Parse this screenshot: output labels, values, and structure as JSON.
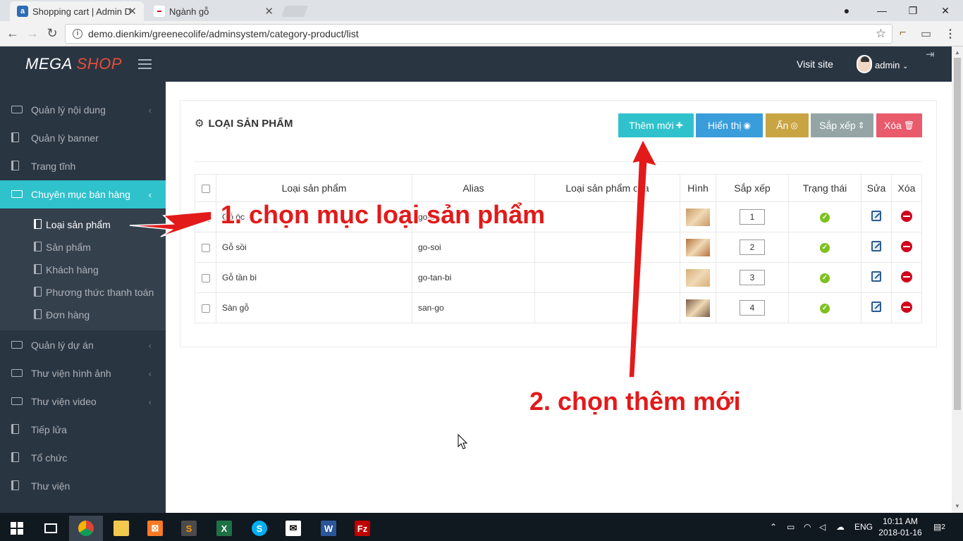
{
  "browser": {
    "tabs": [
      {
        "title": "Shopping cart | Admin D",
        "favicon": "a"
      },
      {
        "title": "Ngành gỗ",
        "favicon": "logo"
      }
    ],
    "url": "demo.dienkim/greenecolife/adminsystem/category-product/list"
  },
  "header": {
    "logo_mega": "MEGA",
    "logo_shop": "SHOP",
    "visit_site": "Visit site",
    "user": "admin"
  },
  "sidebar": {
    "items": [
      {
        "label": "Quản lý nội dung",
        "icon": "folder-icon",
        "chevron": true
      },
      {
        "label": "Quản lý banner",
        "icon": "book-icon",
        "chevron": false
      },
      {
        "label": "Trang tĩnh",
        "icon": "book-icon",
        "chevron": false
      },
      {
        "label": "Chuyên mục bán hàng",
        "icon": "folder-open-icon",
        "chevron": true,
        "active": true
      },
      {
        "label": "Quản lý dự án",
        "icon": "folder-icon",
        "chevron": true
      },
      {
        "label": "Thư viện hình ảnh",
        "icon": "folder-icon",
        "chevron": true
      },
      {
        "label": "Thư viện video",
        "icon": "folder-icon",
        "chevron": true
      },
      {
        "label": "Tiếp lửa",
        "icon": "book-icon",
        "chevron": false
      },
      {
        "label": "Tổ chức",
        "icon": "book-icon",
        "chevron": false
      },
      {
        "label": "Thư viện",
        "icon": "book-icon",
        "chevron": false
      }
    ],
    "subitems": [
      {
        "label": "Loại sản phẩm",
        "current": true
      },
      {
        "label": "Sản phẩm"
      },
      {
        "label": "Khách hàng"
      },
      {
        "label": "Phương thức thanh toán"
      },
      {
        "label": "Đơn hàng"
      }
    ]
  },
  "panel": {
    "title": "LOẠI SẢN PHẨM",
    "buttons": [
      {
        "label": "Thêm mới",
        "icon": "plus-icon",
        "color": "#2fc2cc"
      },
      {
        "label": "Hiển thị",
        "icon": "eye-icon",
        "color": "#3a9ddb"
      },
      {
        "label": "Ẩn",
        "icon": "eye-slash-icon",
        "color": "#c9a443"
      },
      {
        "label": "Sắp xếp",
        "icon": "sort-icon",
        "color": "#95a5a6"
      },
      {
        "label": "Xóa",
        "icon": "trash-icon",
        "color": "#e85a6c"
      }
    ],
    "columns": [
      "Loại sản phẩm",
      "Alias",
      "Loại sản phẩm cha",
      "Hình",
      "Sắp xếp",
      "Trạng thái",
      "Sửa",
      "Xóa"
    ],
    "rows": [
      {
        "name": "Gỗ óc",
        "alias": "go-oc",
        "parent": "",
        "sort": "1",
        "thumb": "#c79a63"
      },
      {
        "name": "Gỗ sồi",
        "alias": "go-soi",
        "parent": "",
        "sort": "2",
        "thumb": "#b5723f"
      },
      {
        "name": "Gỗ tần bì",
        "alias": "go-tan-bi",
        "parent": "",
        "sort": "3",
        "thumb": "#d6b07a"
      },
      {
        "name": "Sàn gỗ",
        "alias": "san-go",
        "parent": "",
        "sort": "4",
        "thumb": "#7a5b45"
      }
    ]
  },
  "annotations": {
    "step1": "1. chọn mục loại sản phẩm",
    "step2": "2. chọn thêm mới"
  },
  "taskbar": {
    "lang": "ENG",
    "time": "10:11 AM",
    "date": "2018-01-16",
    "notifications": "2"
  }
}
